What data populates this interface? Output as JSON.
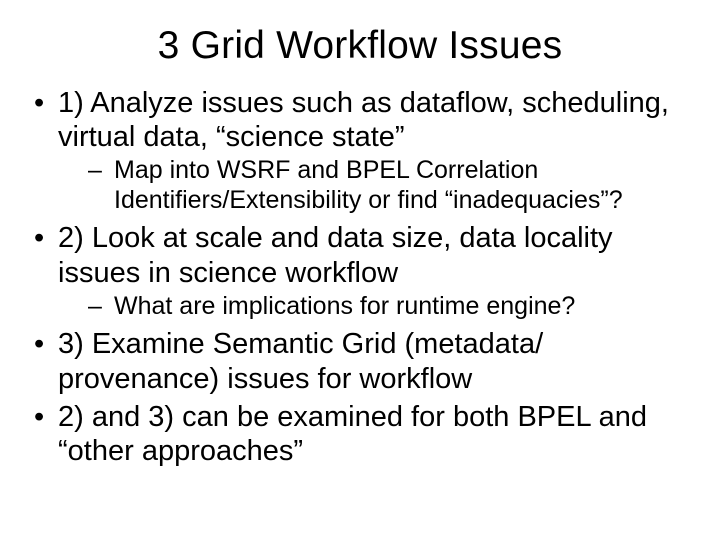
{
  "title": "3 Grid Workflow Issues",
  "bullets": {
    "b1": "1) Analyze issues such as dataflow, scheduling, virtual data, “science state”",
    "b1a": "Map into WSRF and BPEL Correlation Identifiers/Extensibility or find “inadequacies”?",
    "b2": "2) Look at scale and data size, data locality issues in science workflow",
    "b2a": "What are implications for runtime engine?",
    "b3": "3) Examine Semantic Grid (metadata/ provenance) issues for workflow",
    "b4": "2) and 3) can be examined for both BPEL and “other approaches”"
  }
}
